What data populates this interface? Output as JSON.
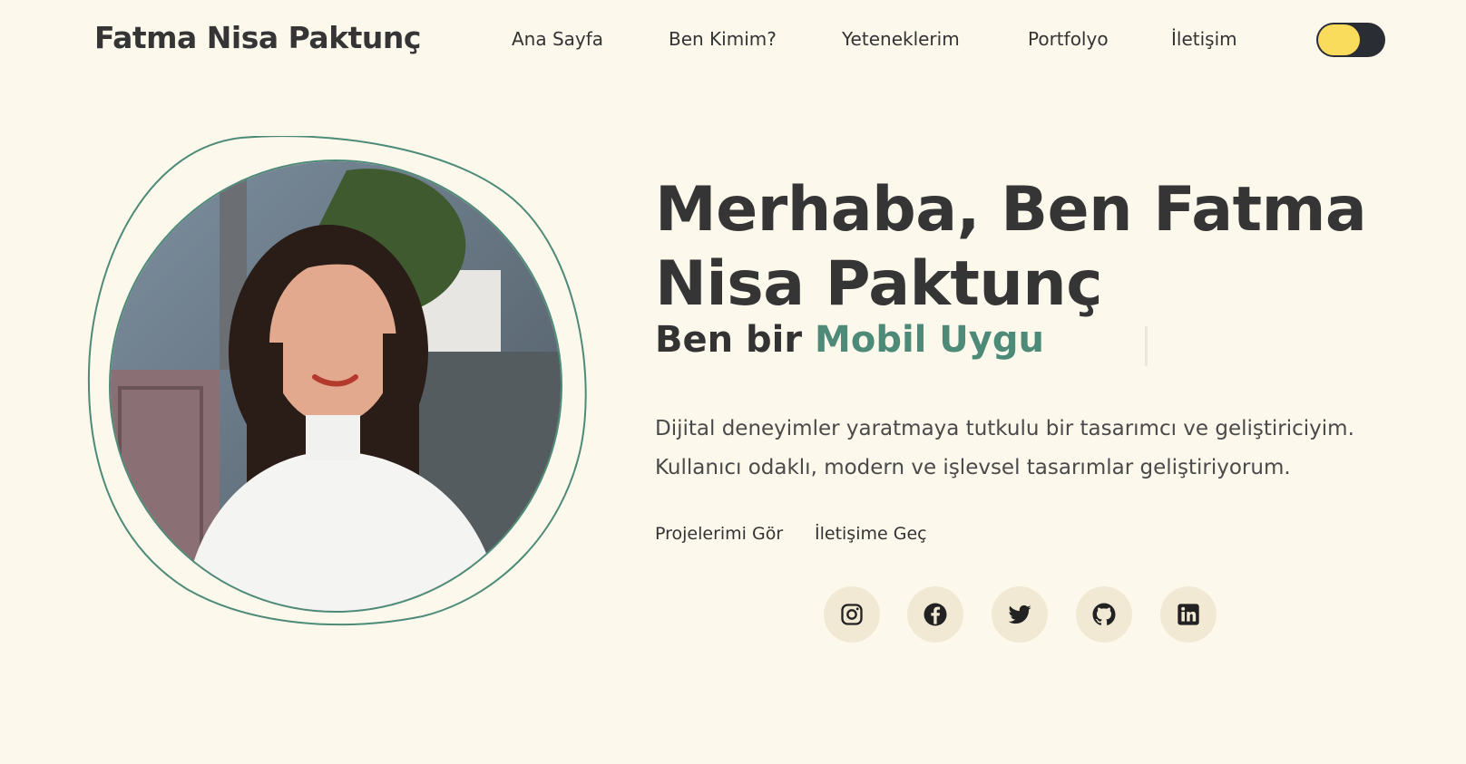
{
  "header": {
    "brand": "Fatma Nisa Paktunç",
    "nav": [
      {
        "label": "Ana Sayfa"
      },
      {
        "label": "Ben Kimim?"
      },
      {
        "label": "Yeteneklerim"
      },
      {
        "label": "Portfolyo"
      },
      {
        "label": "İletişim"
      }
    ],
    "theme_toggle": {
      "state": "light",
      "knob_color": "#fadc5c",
      "track_color": "#2a2d34"
    }
  },
  "hero": {
    "title": "Merhaba, Ben Fatma Nisa Paktunç",
    "subtitle_prefix": "Ben bir",
    "subtitle_typed": "Mobil Uygu",
    "description_line1": "Dijital deneyimler yaratmaya tutkulu bir tasarımcı ve geliştiriciyim.",
    "description_line2": "Kullanıcı odaklı, modern ve işlevsel tasarımlar geliştiriyorum.",
    "buttons": {
      "projects": "Projelerimi Gör",
      "contact": "İletişime Geç"
    },
    "social": [
      {
        "icon": "instagram-icon"
      },
      {
        "icon": "facebook-icon"
      },
      {
        "icon": "twitter-icon"
      },
      {
        "icon": "github-icon"
      },
      {
        "icon": "linkedin-icon"
      }
    ]
  },
  "colors": {
    "background": "#fdf8ec",
    "accent": "#4d8b78",
    "text": "#353535",
    "social_bg": "#f1e9d4"
  }
}
